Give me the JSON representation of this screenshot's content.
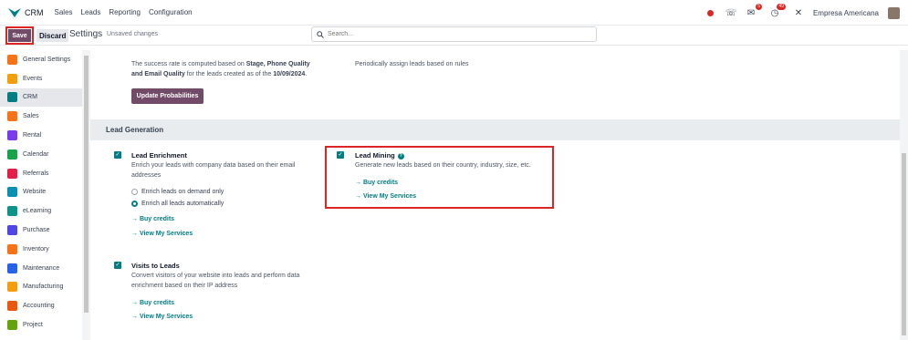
{
  "topnav": {
    "app_name": "CRM",
    "menu": [
      "Sales",
      "Leads",
      "Reporting",
      "Configuration"
    ],
    "company": "Empresa Americana",
    "badge_messages": "5",
    "badge_activities": "49"
  },
  "controlbar": {
    "save_label": "Save",
    "discard_label": "Discard",
    "title": "Settings",
    "unsaved": "Unsaved changes",
    "search_placeholder": "Search..."
  },
  "sidebar": {
    "items": [
      {
        "label": "General Settings",
        "color": "#f97316"
      },
      {
        "label": "Events",
        "color": "#f59e0b"
      },
      {
        "label": "CRM",
        "color": "#017e84",
        "active": true
      },
      {
        "label": "Sales",
        "color": "#f97316"
      },
      {
        "label": "Rental",
        "color": "#7c3aed"
      },
      {
        "label": "Calendar",
        "color": "#16a34a"
      },
      {
        "label": "Referrals",
        "color": "#e11d48"
      },
      {
        "label": "Website",
        "color": "#0891b2"
      },
      {
        "label": "eLearning",
        "color": "#0d9488"
      },
      {
        "label": "Purchase",
        "color": "#4f46e5"
      },
      {
        "label": "Inventory",
        "color": "#f97316"
      },
      {
        "label": "Maintenance",
        "color": "#2563eb"
      },
      {
        "label": "Manufacturing",
        "color": "#f59e0b"
      },
      {
        "label": "Accounting",
        "color": "#ea580c"
      },
      {
        "label": "Project",
        "color": "#65a30d"
      }
    ]
  },
  "predictive": {
    "desc_1": "The success rate is computed based on ",
    "desc_bold_1": "Stage, Phone Quality",
    "desc_2": "and Email Quality",
    "desc_3": " for the leads created as of the ",
    "desc_date": "10/09/2024",
    "desc_end": ".",
    "update_label": "Update Probabilities",
    "right_text": "Periodically assign leads based on rules"
  },
  "section": {
    "title": "Lead Generation"
  },
  "enrichment": {
    "title": "Lead Enrichment",
    "desc_1": "Enrich your leads with company data based on their email",
    "desc_2": "addresses",
    "radio_1": "Enrich leads on demand only",
    "radio_2": "Enrich all leads automatically",
    "link_1": "→ Buy credits",
    "link_2": "→ View My Services"
  },
  "mining": {
    "title": "Lead Mining",
    "desc": "Generate new leads based on their country, industry, size, etc.",
    "link_1": "→ Buy credits",
    "link_2": "→ View My Services"
  },
  "visits": {
    "title": "Visits to Leads",
    "desc_1": "Convert visitors of your website into leads and perform data",
    "desc_2": "enrichment based on their IP address",
    "link_1": "→ Buy credits",
    "link_2": "→ View My Services"
  }
}
